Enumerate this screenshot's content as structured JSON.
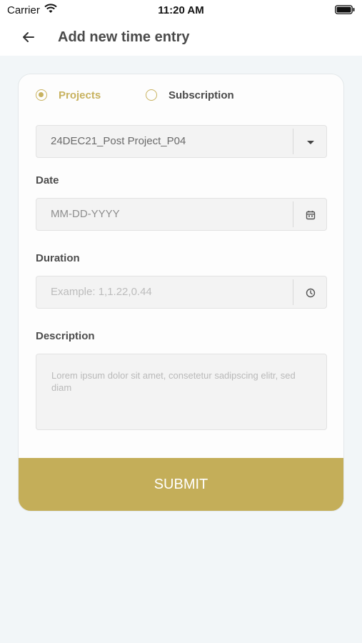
{
  "status_bar": {
    "carrier": "Carrier",
    "time": "11:20 AM"
  },
  "header": {
    "title": "Add new time entry",
    "back_icon": "arrow-left-icon"
  },
  "form": {
    "radio_options": [
      {
        "label": "Projects",
        "selected": true
      },
      {
        "label": "Subscription",
        "selected": false
      }
    ],
    "project_select": {
      "value": "24DEC21_Post Project_P04",
      "icon": "caret-down-icon"
    },
    "date": {
      "label": "Date",
      "placeholder": "MM-DD-YYYY",
      "icon": "calendar-icon"
    },
    "duration": {
      "label": "Duration",
      "placeholder": "Example: 1,1.22,0.44",
      "icon": "clock-icon"
    },
    "description": {
      "label": "Description",
      "placeholder": "Lorem ipsum dolor sit amet, consetetur sadipscing elitr, sed diam"
    },
    "submit_label": "SUBMIT"
  },
  "colors": {
    "accent": "#c4ae59",
    "radio_selected_text": "#c8b25f",
    "text_dark": "#4a4a4a",
    "background": "#f2f6f8"
  }
}
